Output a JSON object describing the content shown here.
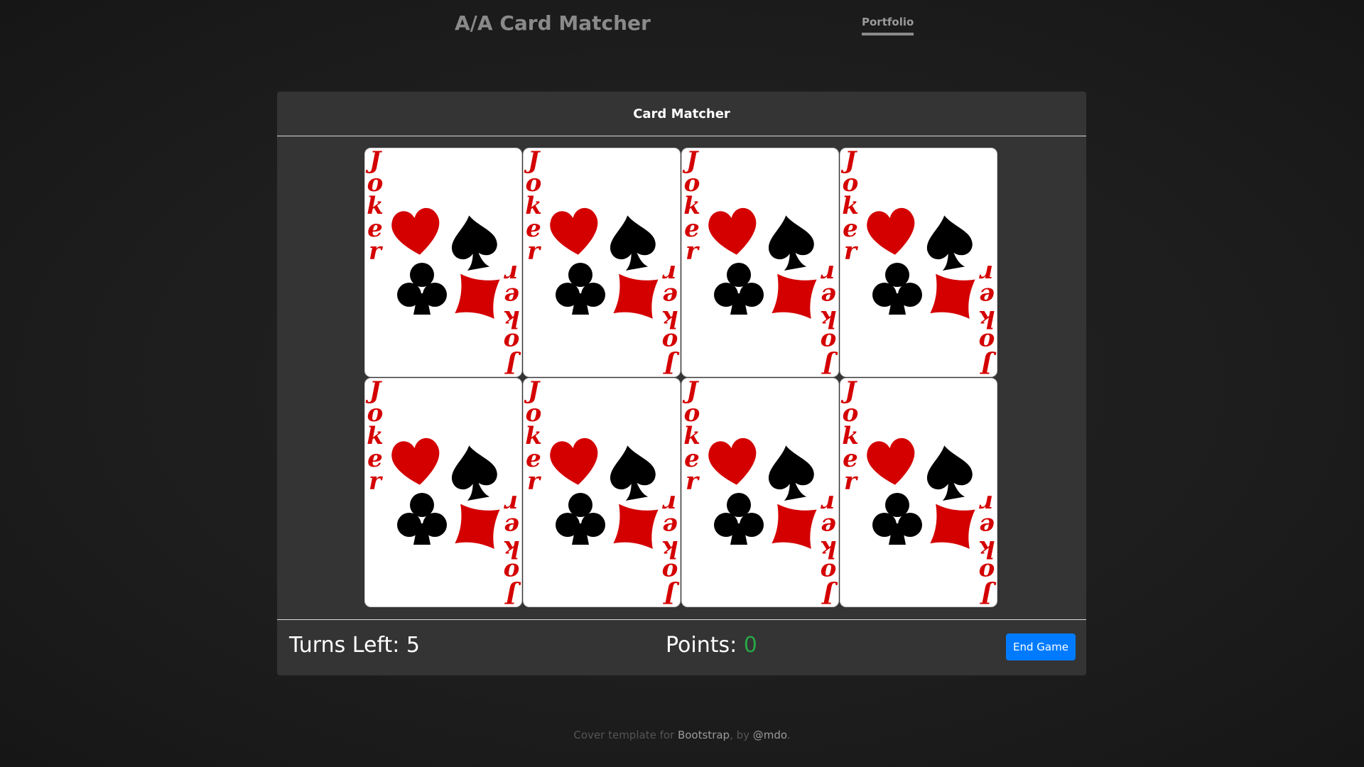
{
  "header": {
    "brand": "A/A Card Matcher",
    "nav_link": "Portfolio"
  },
  "panel": {
    "title": "Card Matcher",
    "cards": [
      {
        "face": "Joker"
      },
      {
        "face": "Joker"
      },
      {
        "face": "Joker"
      },
      {
        "face": "Joker"
      },
      {
        "face": "Joker"
      },
      {
        "face": "Joker"
      },
      {
        "face": "Joker"
      },
      {
        "face": "Joker"
      }
    ]
  },
  "footer_bar": {
    "turns_label": "Turns Left: 5",
    "points_label": "Points:",
    "points_value": "0",
    "end_game_label": "End Game"
  },
  "site_footer": {
    "text_before": "Cover template for ",
    "link1": "Bootstrap",
    "text_middle": ", by ",
    "link2": "@mdo",
    "text_after": "."
  },
  "colors": {
    "background": "#1c1c1c",
    "panel": "#343434",
    "button": "#007bff",
    "points_value": "#28a745",
    "card_red": "#d40000",
    "card_black": "#000000"
  }
}
